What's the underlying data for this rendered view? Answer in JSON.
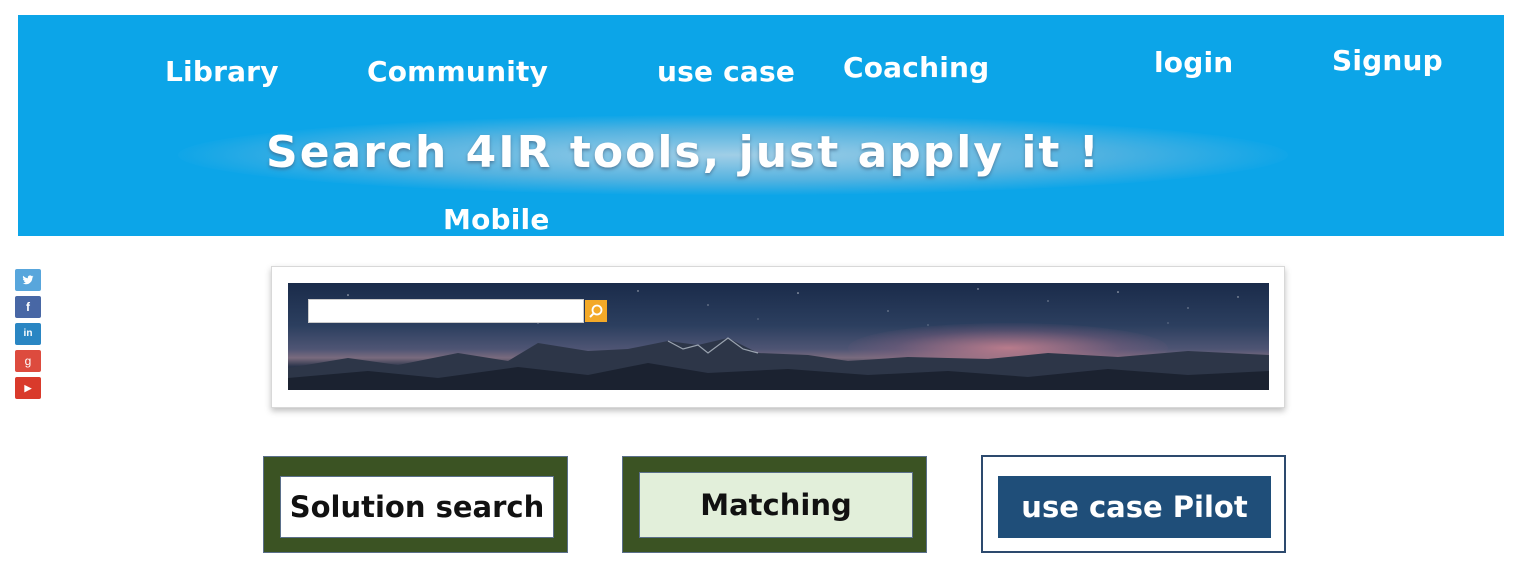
{
  "header": {
    "nav": {
      "library": "Library",
      "community": "Community",
      "use_case": "use case",
      "coaching": "Coaching",
      "login": "login",
      "signup": "Signup",
      "mobile": "Mobile"
    },
    "tagline": "Search 4IR tools, just apply it !",
    "background_color": "#0ca5e8"
  },
  "social": {
    "icons": [
      {
        "name": "twitter-icon",
        "glyph": "t",
        "color": "#58a6dc"
      },
      {
        "name": "facebook-icon",
        "glyph": "f",
        "color": "#4867a5"
      },
      {
        "name": "linkedin-icon",
        "glyph": "in",
        "color": "#2a86c3"
      },
      {
        "name": "google-plus-icon",
        "glyph": "g",
        "color": "#dd4b3e"
      },
      {
        "name": "youtube-icon",
        "glyph": "▶",
        "color": "#d93a2b"
      }
    ]
  },
  "search": {
    "value": "",
    "placeholder": "",
    "button_icon": "search-icon",
    "button_color": "#f3a928"
  },
  "actions": {
    "solution_search": "Solution search",
    "matching": "Matching",
    "use_case_pilot": "use case Pilot"
  }
}
